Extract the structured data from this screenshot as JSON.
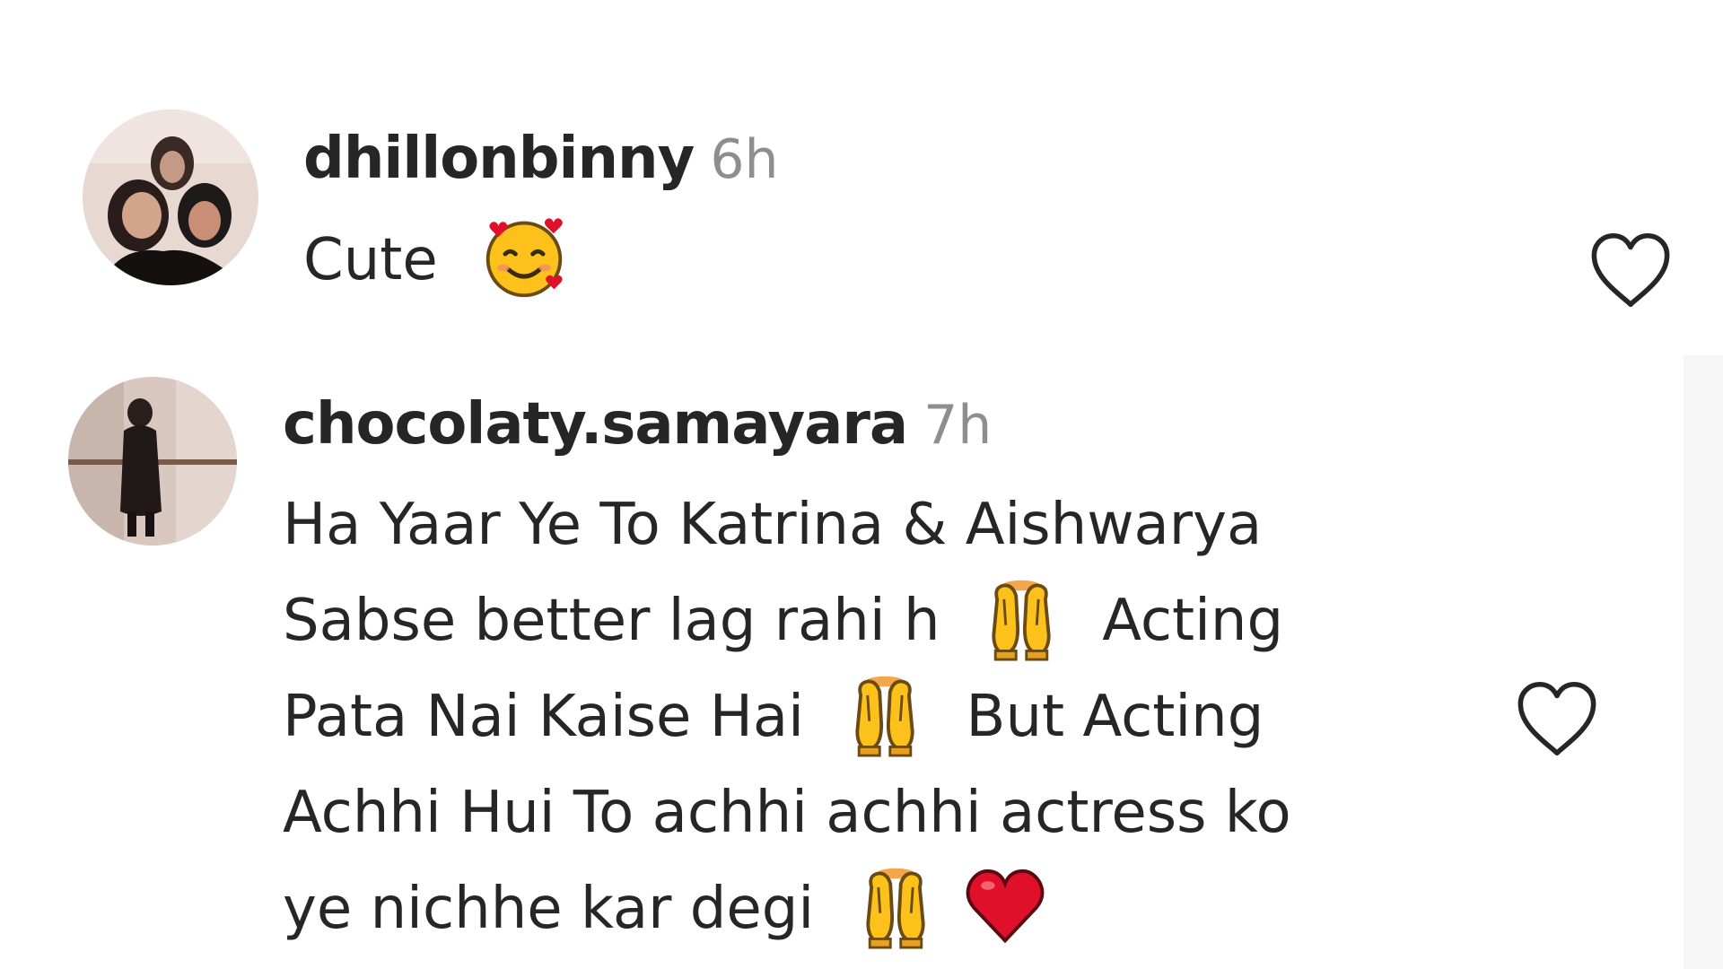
{
  "comments": [
    {
      "username": "dhillonbinny",
      "time": "6h",
      "text_lines": [
        "Cute"
      ],
      "emojis": [
        "smiling-face-with-hearts"
      ],
      "like_icon": "heart-outline-icon"
    },
    {
      "username": "chocolaty.samayara",
      "time": "7h",
      "text_lines": [
        "Ha Yaar Ye To Katrina & Aishwarya",
        "Sabse better lag rahi h",
        "Acting",
        "Pata Nai Kaise Hai",
        "But Acting",
        "Achhi Hui To achhi achhi actress ko",
        "ye nichhe kar degi"
      ],
      "emojis": [
        "raising-hands",
        "raising-hands",
        "raising-hands",
        "red-heart"
      ],
      "like_icon": "heart-outline-icon"
    }
  ],
  "colors": {
    "text": "#262626",
    "meta": "#8e8e8e",
    "heart": "#e0102a"
  }
}
